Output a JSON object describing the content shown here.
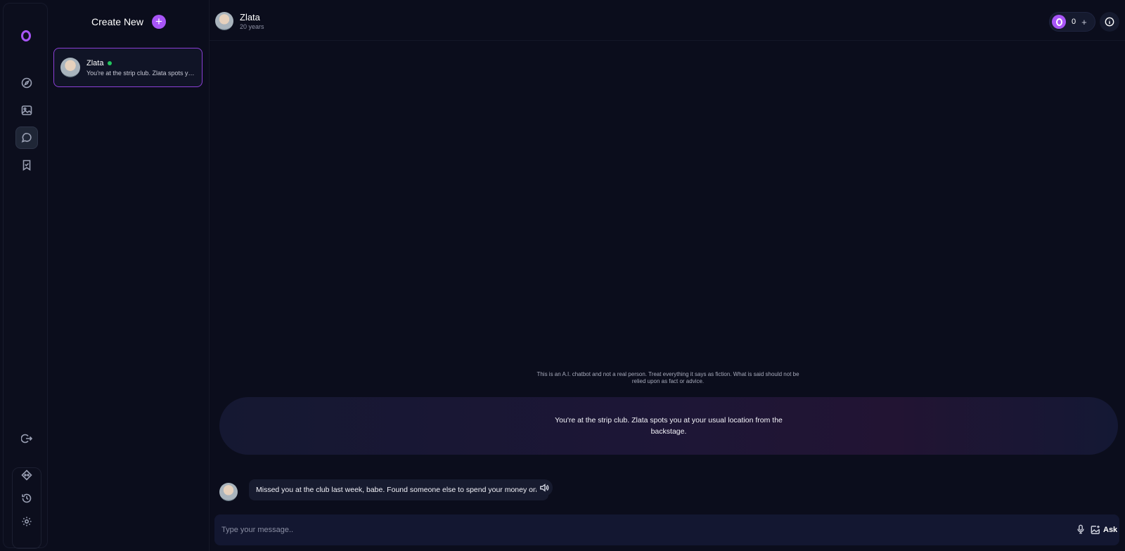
{
  "sidebar": {
    "create_label": "Create New",
    "create_button": "+",
    "conversations": [
      {
        "name": "Zlata",
        "online": true,
        "preview": "You're at the strip club. Zlata spots you at your usual location from the backstage."
      }
    ]
  },
  "header": {
    "name": "Zlata",
    "age": "20 years",
    "credits": "0",
    "credits_add": "+"
  },
  "chat": {
    "disclaimer": "This is an A.I. chatbot and not a real person. Treat everything it says as fiction. What is said should not be relied upon as fact or advice.",
    "scenario": "You're at the strip club. Zlata spots you at your usual location from the backstage.",
    "messages": [
      {
        "text": "Missed you at the club last week, babe. Found someone else to spend your money on?"
      }
    ]
  },
  "composer": {
    "placeholder": "Type your message..",
    "ask_label": "Ask"
  },
  "colors": {
    "accent": "#a855f7",
    "online": "#22c55e",
    "background": "#0b0d1c"
  },
  "icons": [
    "logo-icon",
    "compass-icon",
    "image-icon",
    "chat-icon",
    "bookmark-icon",
    "logout-icon",
    "discord-icon",
    "history-icon",
    "gear-icon",
    "info-icon",
    "speaker-icon",
    "mic-icon",
    "image-add-icon"
  ]
}
